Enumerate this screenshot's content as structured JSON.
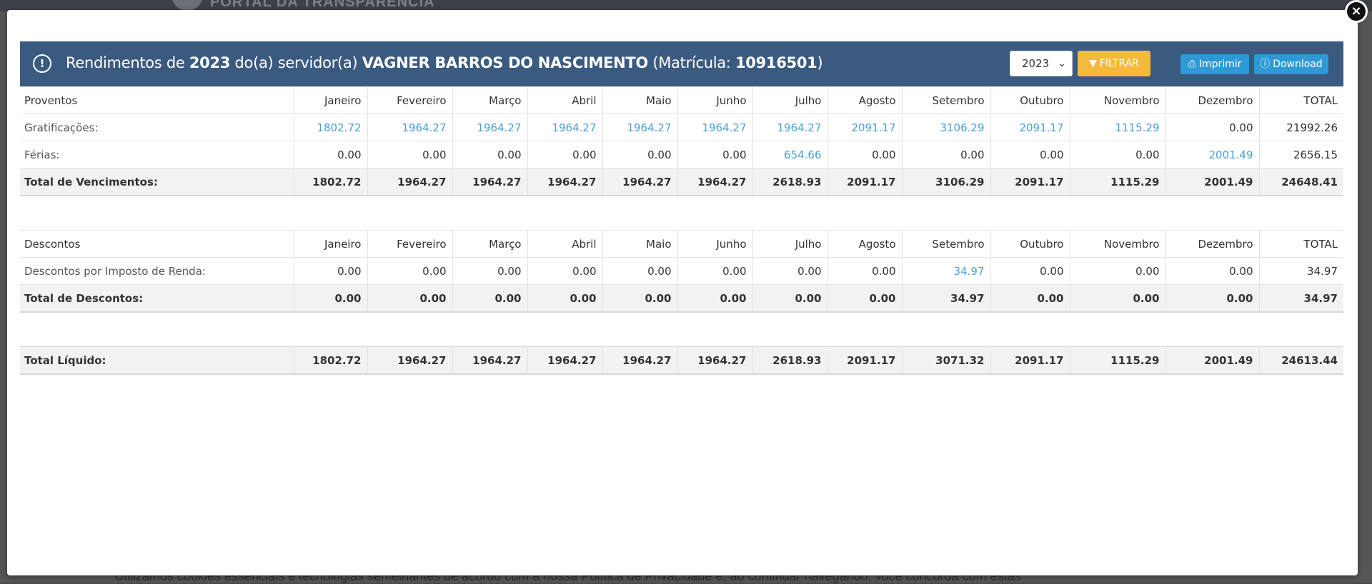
{
  "background": {
    "portal_name": "PORTAL DA TRANSPARÊNCIA",
    "footer_text": "Utilizamos cookies essenciais e tecnologias semelhantes de acordo com a nossa Política de Privacidade e, ao continuar navegando, você concorda com estas"
  },
  "modal": {
    "close_label": "×",
    "header": {
      "icon": "exclamation-circle-icon",
      "title_prefix": "Rendimentos de ",
      "year": "2023",
      "title_mid": " do(a) servidor(a) ",
      "employee_name": "VAGNER BARROS DO NASCIMENTO",
      "title_matricula_prefix": " (Matrícula: ",
      "matricula": "10916501",
      "title_suffix": ")"
    },
    "year_select": {
      "value": "2023",
      "icon": "chevron-down-icon"
    },
    "filter_button": {
      "label": "FILTRAR",
      "icon": "filter-icon"
    },
    "print_button": {
      "label": "Imprimir",
      "icon": "printer-icon"
    },
    "download_button": {
      "label": "Download",
      "icon": "info-circle-icon"
    }
  },
  "colors": {
    "header_bg": "#3a5a80",
    "filter_btn": "#f5b93b",
    "action_btn": "#2d9ad6",
    "link_value": "#4a9fd8",
    "total_row_bg": "#f2f2f2"
  },
  "proventos": {
    "columns": [
      "Proventos",
      "Janeiro",
      "Fevereiro",
      "Março",
      "Abril",
      "Maio",
      "Junho",
      "Julho",
      "Agosto",
      "Setembro",
      "Outubro",
      "Novembro",
      "Dezembro",
      "TOTAL"
    ],
    "rows": [
      {
        "label": "Gratificações:",
        "values": [
          "1802.72",
          "1964.27",
          "1964.27",
          "1964.27",
          "1964.27",
          "1964.27",
          "1964.27",
          "2091.17",
          "3106.29",
          "2091.17",
          "1115.29",
          "0.00",
          "21992.26"
        ]
      },
      {
        "label": "Férias:",
        "values": [
          "0.00",
          "0.00",
          "0.00",
          "0.00",
          "0.00",
          "0.00",
          "654.66",
          "0.00",
          "0.00",
          "0.00",
          "0.00",
          "2001.49",
          "2656.15"
        ]
      }
    ],
    "total": {
      "label": "Total de Vencimentos:",
      "values": [
        "1802.72",
        "1964.27",
        "1964.27",
        "1964.27",
        "1964.27",
        "1964.27",
        "2618.93",
        "2091.17",
        "3106.29",
        "2091.17",
        "1115.29",
        "2001.49",
        "24648.41"
      ]
    }
  },
  "descontos": {
    "columns": [
      "Descontos",
      "Janeiro",
      "Fevereiro",
      "Março",
      "Abril",
      "Maio",
      "Junho",
      "Julho",
      "Agosto",
      "Setembro",
      "Outubro",
      "Novembro",
      "Dezembro",
      "TOTAL"
    ],
    "rows": [
      {
        "label": "Descontos por Imposto de Renda:",
        "values": [
          "0.00",
          "0.00",
          "0.00",
          "0.00",
          "0.00",
          "0.00",
          "0.00",
          "0.00",
          "34.97",
          "0.00",
          "0.00",
          "0.00",
          "34.97"
        ]
      }
    ],
    "total": {
      "label": "Total de Descontos:",
      "values": [
        "0.00",
        "0.00",
        "0.00",
        "0.00",
        "0.00",
        "0.00",
        "0.00",
        "0.00",
        "34.97",
        "0.00",
        "0.00",
        "0.00",
        "34.97"
      ]
    }
  },
  "liquido": {
    "total": {
      "label": "Total Líquido:",
      "values": [
        "1802.72",
        "1964.27",
        "1964.27",
        "1964.27",
        "1964.27",
        "1964.27",
        "2618.93",
        "2091.17",
        "3071.32",
        "2091.17",
        "1115.29",
        "2001.49",
        "24613.44"
      ]
    }
  }
}
